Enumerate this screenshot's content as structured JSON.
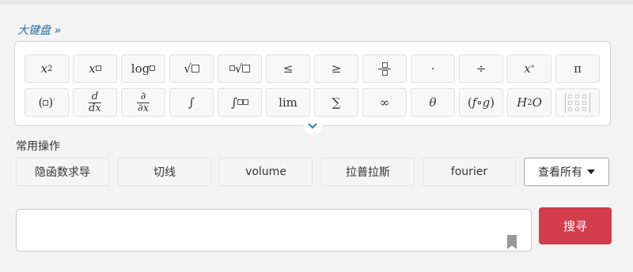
{
  "keyboard": {
    "title": "大键盘 »",
    "row1": [
      "x²",
      "x□",
      "log□",
      "√□",
      "∜□",
      "≤",
      "≥",
      "□/□",
      "·",
      "÷",
      "x°",
      "π"
    ],
    "row2": [
      "(□)′",
      "d/dx",
      "∂/∂x",
      "∫",
      "∫□",
      "lim",
      "∑",
      "∞",
      "θ",
      "(f∘g)",
      "H₂O",
      "matrix"
    ]
  },
  "common_ops": {
    "title": "常用操作",
    "items": [
      "隐函数求导",
      "切线",
      "volume",
      "拉普拉斯",
      "fourier"
    ],
    "view_all": "查看所有"
  },
  "search": {
    "value": "",
    "button": "搜寻"
  }
}
